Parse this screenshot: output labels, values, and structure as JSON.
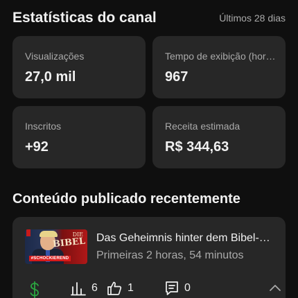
{
  "header": {
    "title": "Estatísticas do canal",
    "period": "Últimos 28 dias"
  },
  "stats": [
    {
      "label": "Visualizações",
      "value": "27,0 mil"
    },
    {
      "label": "Tempo de exibição (horas)",
      "value": "967"
    },
    {
      "label": "Inscritos",
      "value": "+92"
    },
    {
      "label": "Receita estimada",
      "value": "R$ 344,63"
    }
  ],
  "recent": {
    "section_title": "Conteúdo publicado recentemente",
    "video": {
      "title": "Das Geheimnis hinter dem Bibel-Code",
      "meta": "Primeiras 2 horas, 54 minutos",
      "thumbnail_text": {
        "top": "DIE",
        "main": "BIBEL",
        "banner": "#SCHOCKIEREND"
      },
      "views": "6",
      "likes": "1",
      "comments": "0"
    }
  },
  "icons": {
    "revenue": "dollar-icon",
    "views": "bar-chart-icon",
    "likes": "thumbs-up-icon",
    "comments": "comment-icon",
    "expand": "chevron-up-icon"
  },
  "colors": {
    "background": "#0f0f0f",
    "card": "#272727",
    "text_primary": "#f1f1f1",
    "text_secondary": "#aaaaaa",
    "revenue_green": "#2ba640"
  }
}
